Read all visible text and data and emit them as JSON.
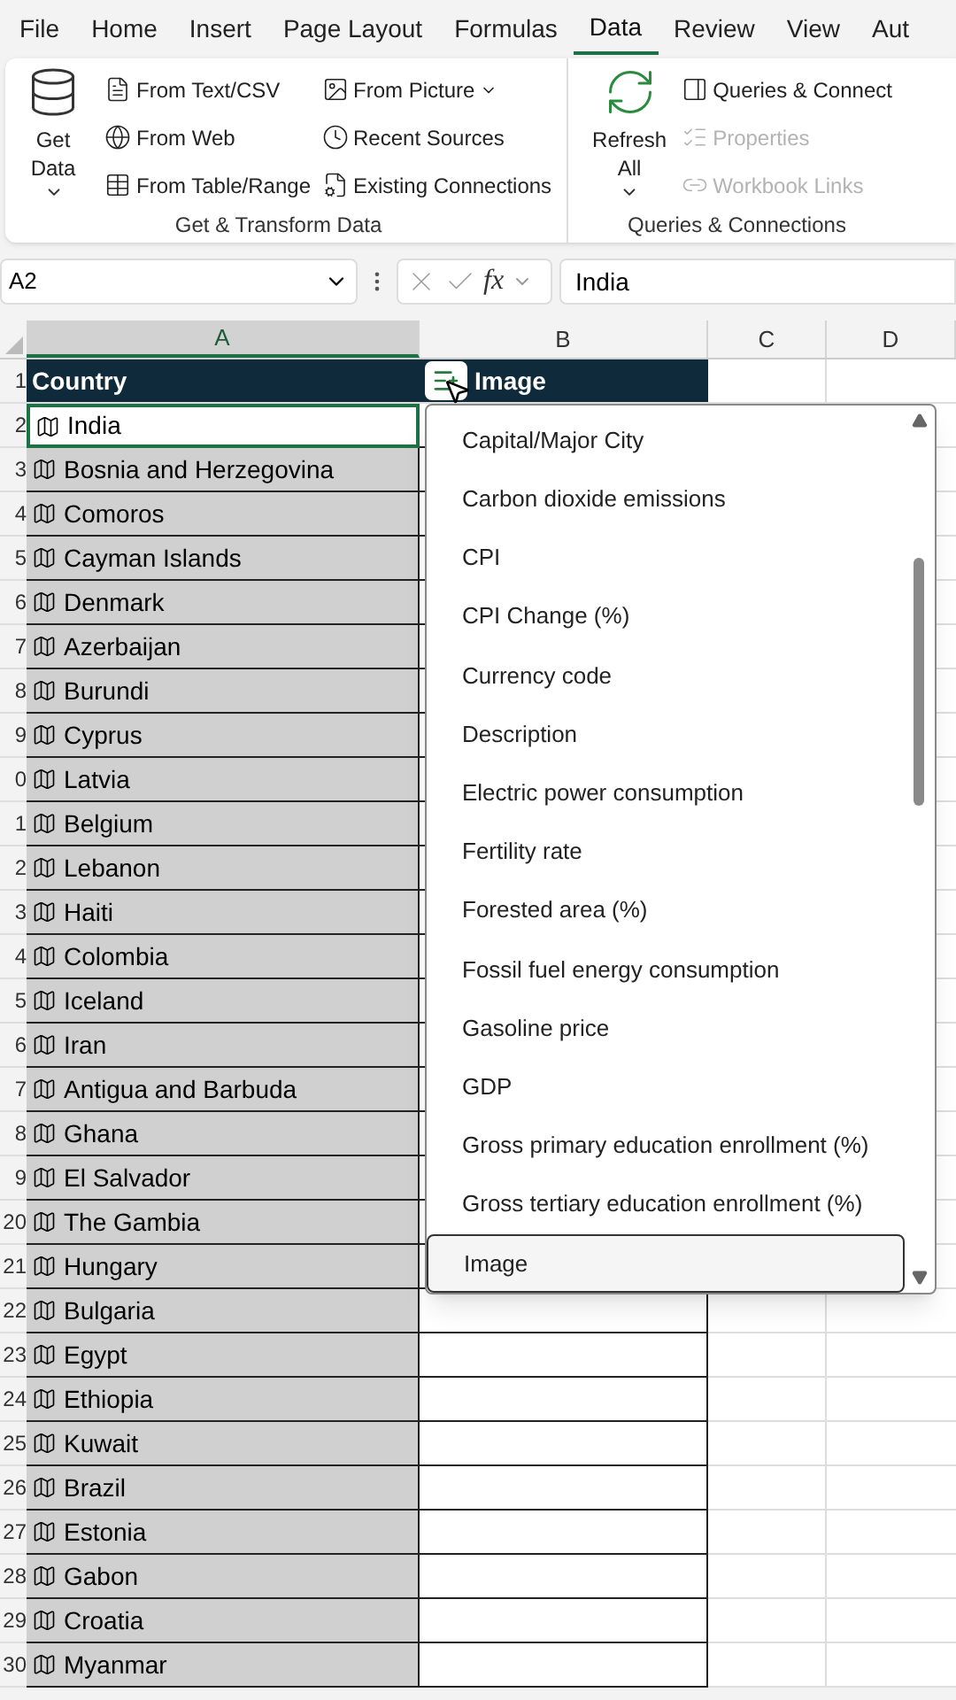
{
  "tabs": [
    {
      "label": "File",
      "selected": false
    },
    {
      "label": "Home",
      "selected": false
    },
    {
      "label": "Insert",
      "selected": false
    },
    {
      "label": "Page Layout",
      "selected": false
    },
    {
      "label": "Formulas",
      "selected": false
    },
    {
      "label": "Data",
      "selected": true
    },
    {
      "label": "Review",
      "selected": false
    },
    {
      "label": "View",
      "selected": false
    },
    {
      "label": "Aut",
      "selected": false
    }
  ],
  "ribbon": {
    "groups": [
      {
        "label": "Get & Transform Data",
        "big": {
          "label": "Get Data",
          "kind": "get"
        },
        "columns": [
          [
            {
              "label": "From Text/CSV",
              "disabled": false,
              "dropdown": false
            },
            {
              "label": "From Web",
              "disabled": false,
              "dropdown": false
            },
            {
              "label": "From Table/Range",
              "disabled": false,
              "dropdown": false
            }
          ],
          [
            {
              "label": "From Picture",
              "disabled": false,
              "dropdown": true
            },
            {
              "label": "Recent Sources",
              "disabled": false,
              "dropdown": false
            },
            {
              "label": "Existing Connections",
              "disabled": false,
              "dropdown": false
            }
          ]
        ]
      },
      {
        "label": "Queries & Connections",
        "big": {
          "label": "Refresh All",
          "kind": "refresh"
        },
        "columns": [
          [
            {
              "label": "Queries & Connect",
              "disabled": false,
              "dropdown": false
            },
            {
              "label": "Properties",
              "disabled": true,
              "dropdown": false
            },
            {
              "label": "Workbook Links",
              "disabled": true,
              "dropdown": false
            }
          ]
        ]
      }
    ]
  },
  "formula_bar": {
    "name_box": "A2",
    "fx": "fx",
    "value": "India"
  },
  "columns": [
    {
      "label": "A",
      "selected": true
    },
    {
      "label": "B",
      "selected": false
    },
    {
      "label": "C",
      "selected": false
    },
    {
      "label": "D",
      "selected": false
    }
  ],
  "header_row": {
    "row_label": "1",
    "cells": [
      "Country",
      "Image"
    ]
  },
  "rows": [
    {
      "row_label": "2",
      "country": "India",
      "active": true
    },
    {
      "row_label": "3",
      "country": "Bosnia and Herzegovina",
      "active": false
    },
    {
      "row_label": "4",
      "country": "Comoros",
      "active": false
    },
    {
      "row_label": "5",
      "country": "Cayman Islands",
      "active": false
    },
    {
      "row_label": "6",
      "country": "Denmark",
      "active": false
    },
    {
      "row_label": "7",
      "country": "Azerbaijan",
      "active": false
    },
    {
      "row_label": "8",
      "country": "Burundi",
      "active": false
    },
    {
      "row_label": "9",
      "country": "Cyprus",
      "active": false
    },
    {
      "row_label": "0",
      "country": "Latvia",
      "active": false
    },
    {
      "row_label": "1",
      "country": "Belgium",
      "active": false
    },
    {
      "row_label": "2",
      "country": "Lebanon",
      "active": false
    },
    {
      "row_label": "3",
      "country": "Haiti",
      "active": false
    },
    {
      "row_label": "4",
      "country": "Colombia",
      "active": false
    },
    {
      "row_label": "5",
      "country": "Iceland",
      "active": false
    },
    {
      "row_label": "6",
      "country": "Iran",
      "active": false
    },
    {
      "row_label": "7",
      "country": "Antigua and Barbuda",
      "active": false
    },
    {
      "row_label": "8",
      "country": "Ghana",
      "active": false
    },
    {
      "row_label": "9",
      "country": "El Salvador",
      "active": false
    },
    {
      "row_label": "20",
      "country": "The Gambia",
      "active": false
    },
    {
      "row_label": "21",
      "country": "Hungary",
      "active": false
    },
    {
      "row_label": "22",
      "country": "Bulgaria",
      "active": false
    },
    {
      "row_label": "23",
      "country": "Egypt",
      "active": false
    },
    {
      "row_label": "24",
      "country": "Ethiopia",
      "active": false
    },
    {
      "row_label": "25",
      "country": "Kuwait",
      "active": false
    },
    {
      "row_label": "26",
      "country": "Brazil",
      "active": false
    },
    {
      "row_label": "27",
      "country": "Estonia",
      "active": false
    },
    {
      "row_label": "28",
      "country": "Gabon",
      "active": false
    },
    {
      "row_label": "29",
      "country": "Croatia",
      "active": false
    },
    {
      "row_label": "30",
      "country": "Myanmar",
      "active": false
    }
  ],
  "field_list": [
    {
      "label": "Capital/Major City",
      "selected": false
    },
    {
      "label": "Carbon dioxide emissions",
      "selected": false
    },
    {
      "label": "CPI",
      "selected": false
    },
    {
      "label": "CPI Change (%)",
      "selected": false
    },
    {
      "label": "Currency code",
      "selected": false
    },
    {
      "label": "Description",
      "selected": false
    },
    {
      "label": "Electric power consumption",
      "selected": false
    },
    {
      "label": "Fertility rate",
      "selected": false
    },
    {
      "label": "Forested area (%)",
      "selected": false
    },
    {
      "label": "Fossil fuel energy consumption",
      "selected": false
    },
    {
      "label": "Gasoline price",
      "selected": false
    },
    {
      "label": "GDP",
      "selected": false
    },
    {
      "label": "Gross primary education enrollment (%)",
      "selected": false
    },
    {
      "label": "Gross tertiary education enrollment (%)",
      "selected": false
    },
    {
      "label": "Image",
      "selected": true
    }
  ]
}
